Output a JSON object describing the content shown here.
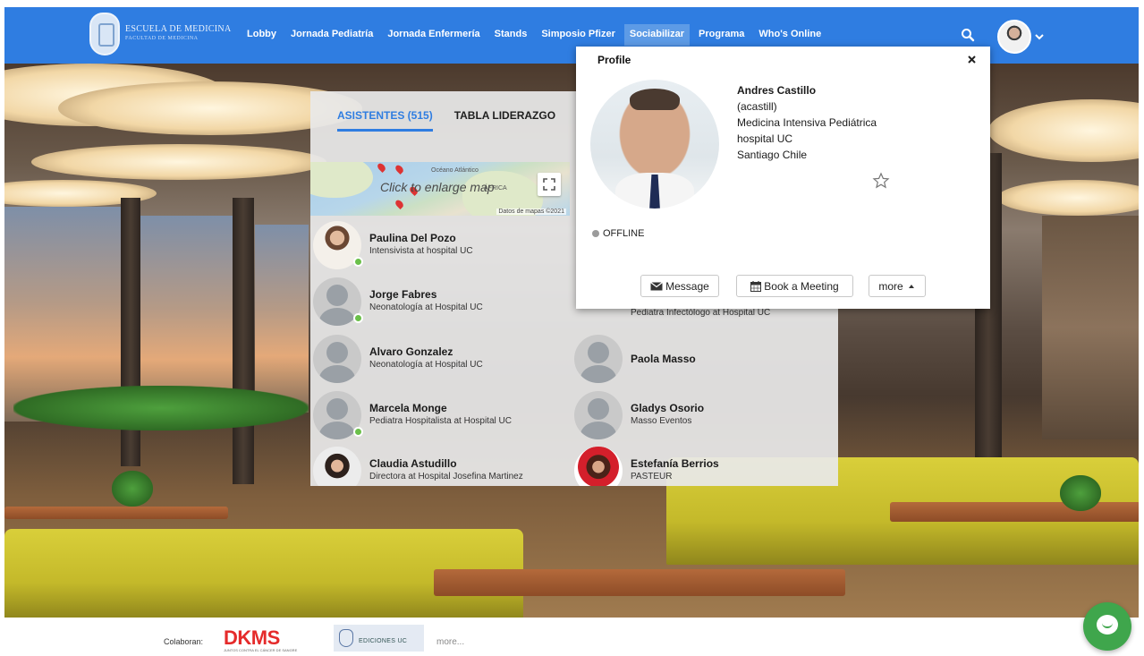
{
  "brand": {
    "line1": "ESCUELA DE MEDICINA",
    "line2": "FACULTAD DE MEDICINA"
  },
  "nav": {
    "items": [
      {
        "label": "Lobby",
        "active": false
      },
      {
        "label": "Jornada Pediatría",
        "active": false
      },
      {
        "label": "Jornada Enfermería",
        "active": false
      },
      {
        "label": "Stands",
        "active": false
      },
      {
        "label": "Simposio Pfizer",
        "active": false
      },
      {
        "label": "Sociabilizar",
        "active": true
      },
      {
        "label": "Programa",
        "active": false
      },
      {
        "label": "Who's Online",
        "active": false
      }
    ],
    "search_icon": "search-icon",
    "avatar_icon": "user-avatar",
    "chevron_icon": "chevron-down-icon"
  },
  "panel": {
    "tabs": {
      "attendees": "ASISTENTES (515)",
      "leaderboard": "TABLA LIDERAZGO"
    },
    "map": {
      "hint": "Click to enlarge map",
      "credit": "Datos de mapas ©2021",
      "label_africa": "ÁFRICA",
      "label_ocean": "Océano Atlántico"
    },
    "attendees": [
      {
        "name": "Paulina Del Pozo",
        "role": "Intensivista at hospital UC",
        "online": true,
        "photo": "woman1"
      },
      {
        "name": "Jorge Fabres",
        "role": "Neonatología at Hospital UC",
        "online": true,
        "photo": "silhouette"
      },
      {
        "name": "Alvaro Gonzalez",
        "role": "Neonatología at Hospital UC",
        "online": false,
        "photo": "silhouette"
      },
      {
        "name": "Marcela Monge",
        "role": "Pediatra Hospitalista at Hospital UC",
        "online": true,
        "photo": "silhouette"
      },
      {
        "name": "Claudia Astudillo",
        "role": "Directora at Hospital Josefina Martinez",
        "online": false,
        "photo": "woman2"
      }
    ],
    "attendees_right": [
      {
        "name": "",
        "role": "Pediatra Infectólogo at Hospital UC",
        "online": false,
        "photo": "silhouette"
      },
      {
        "name": "Paola Masso",
        "role": "",
        "online": false,
        "photo": "silhouette"
      },
      {
        "name": "Gladys Osorio",
        "role": "Masso Eventos",
        "online": false,
        "photo": "silhouette"
      },
      {
        "name": "Estefanía Berrios",
        "role": "PASTEUR",
        "online": false,
        "photo": "woman3"
      }
    ]
  },
  "profile": {
    "title": "Profile",
    "full_name": "Andres Castillo",
    "username": "(acastill)",
    "specialty": "Medicina Intensiva Pediátrica",
    "institution": "hospital UC",
    "location": "Santiago Chile",
    "status": "OFFLINE",
    "buttons": {
      "message": "Message",
      "meeting": "Book a Meeting",
      "more": "more"
    },
    "icons": {
      "close": "close-icon",
      "star": "star-icon",
      "envelope": "envelope-icon",
      "calendar": "calendar-icon",
      "caret": "caret-up-icon"
    }
  },
  "footer": {
    "colab_label": "Colaboran:",
    "sponsor1": "DKMS",
    "sponsor1_tagline": "JUNTOS CONTRA EL CÁNCER DE SANGRE",
    "sponsor2": "EDICIONES UC",
    "more": "more..."
  },
  "colors": {
    "nav_bg": "#2f7de1",
    "accent": "#2f7de1",
    "online": "#6bc04a",
    "offline": "#9b9b9b",
    "dkms_red": "#e52b2b",
    "chat_green": "#3fa64c"
  }
}
